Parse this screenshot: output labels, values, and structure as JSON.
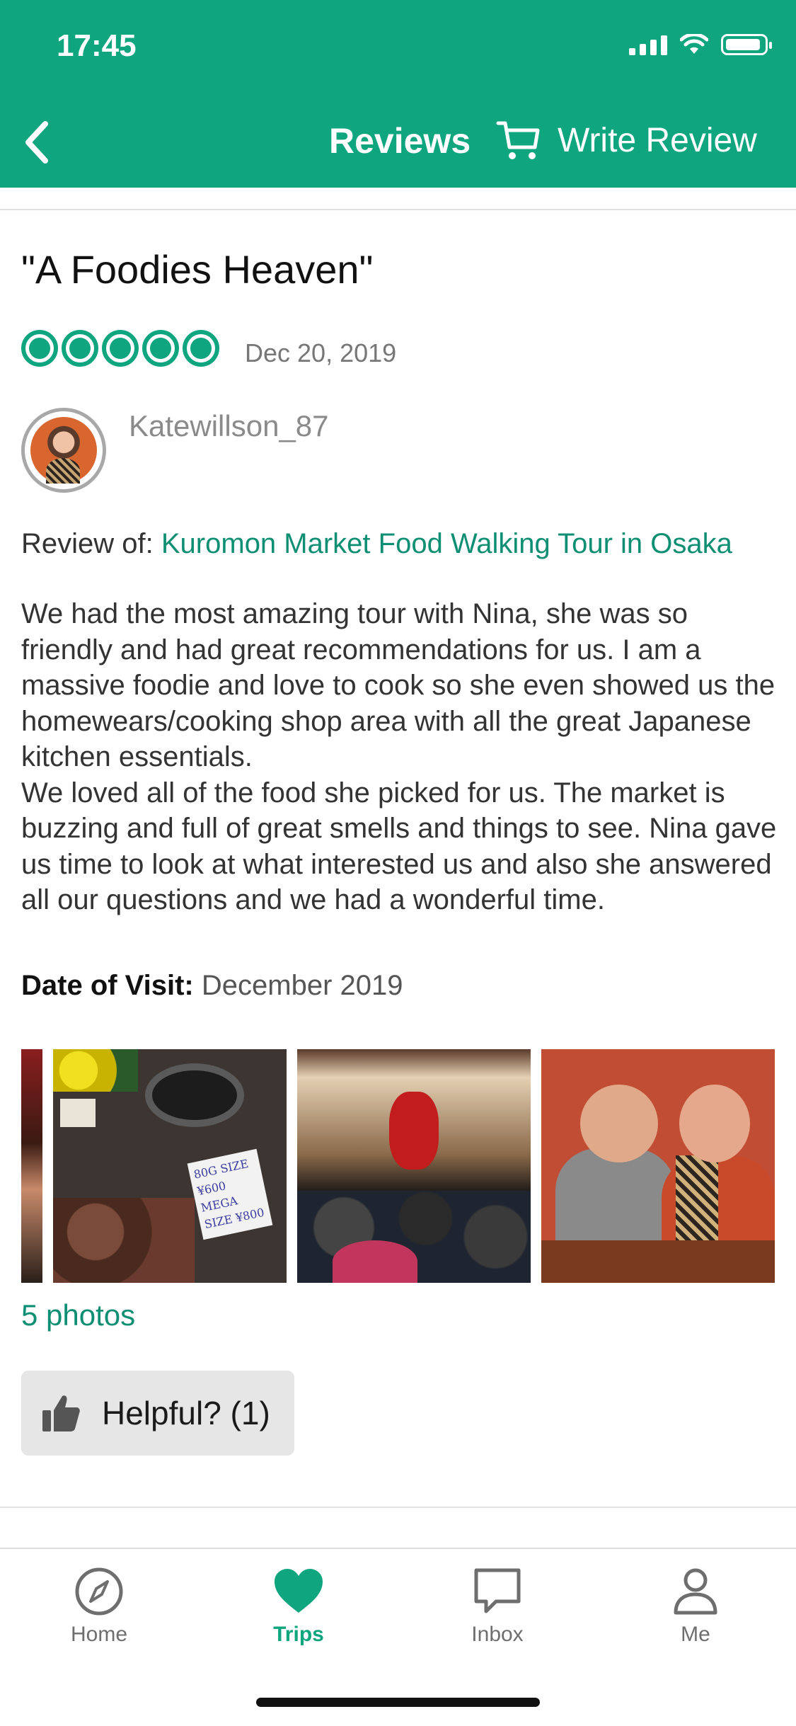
{
  "status_bar": {
    "time": "17:45"
  },
  "header": {
    "title": "Reviews",
    "write_review_label": "Write Review",
    "back_icon": "chevron-left-icon",
    "cart_icon": "cart-icon",
    "color": "#0ea57f"
  },
  "review": {
    "title": "\"A Foodies Heaven\"",
    "rating": 5,
    "date": "Dec 20, 2019",
    "username": "Katewillson_87",
    "review_of_label": "Review of:",
    "review_of_link": "Kuromon Market Food Walking Tour in Osaka",
    "body": [
      "We had the most amazing tour with Nina, she was so friendly and had great recommendations for us. I am a massive foodie and love to cook so she even showed us the homewears/cooking shop area with all the great Japanese kitchen essentials.",
      "We loved all of the food she picked for us. The market is buzzing and full of great smells and things to see. Nina gave us time to look at what interested us and also she answered all our questions and we had a wonderful time."
    ],
    "date_of_visit_label": "Date of Visit:",
    "date_of_visit": "December 2019",
    "photos_count": "5 photos",
    "helpful_label": "Helpful? (1)",
    "photo_sign_text": "80G SIZE ¥600 MEGA SIZE ¥800"
  },
  "tabs": [
    {
      "label": "Home",
      "icon": "compass-icon",
      "active": false
    },
    {
      "label": "Trips",
      "icon": "heart-icon",
      "active": true
    },
    {
      "label": "Inbox",
      "icon": "chat-icon",
      "active": false
    },
    {
      "label": "Me",
      "icon": "person-icon",
      "active": false
    }
  ],
  "colors": {
    "brand": "#0ea57f",
    "link": "#0e8f73"
  }
}
